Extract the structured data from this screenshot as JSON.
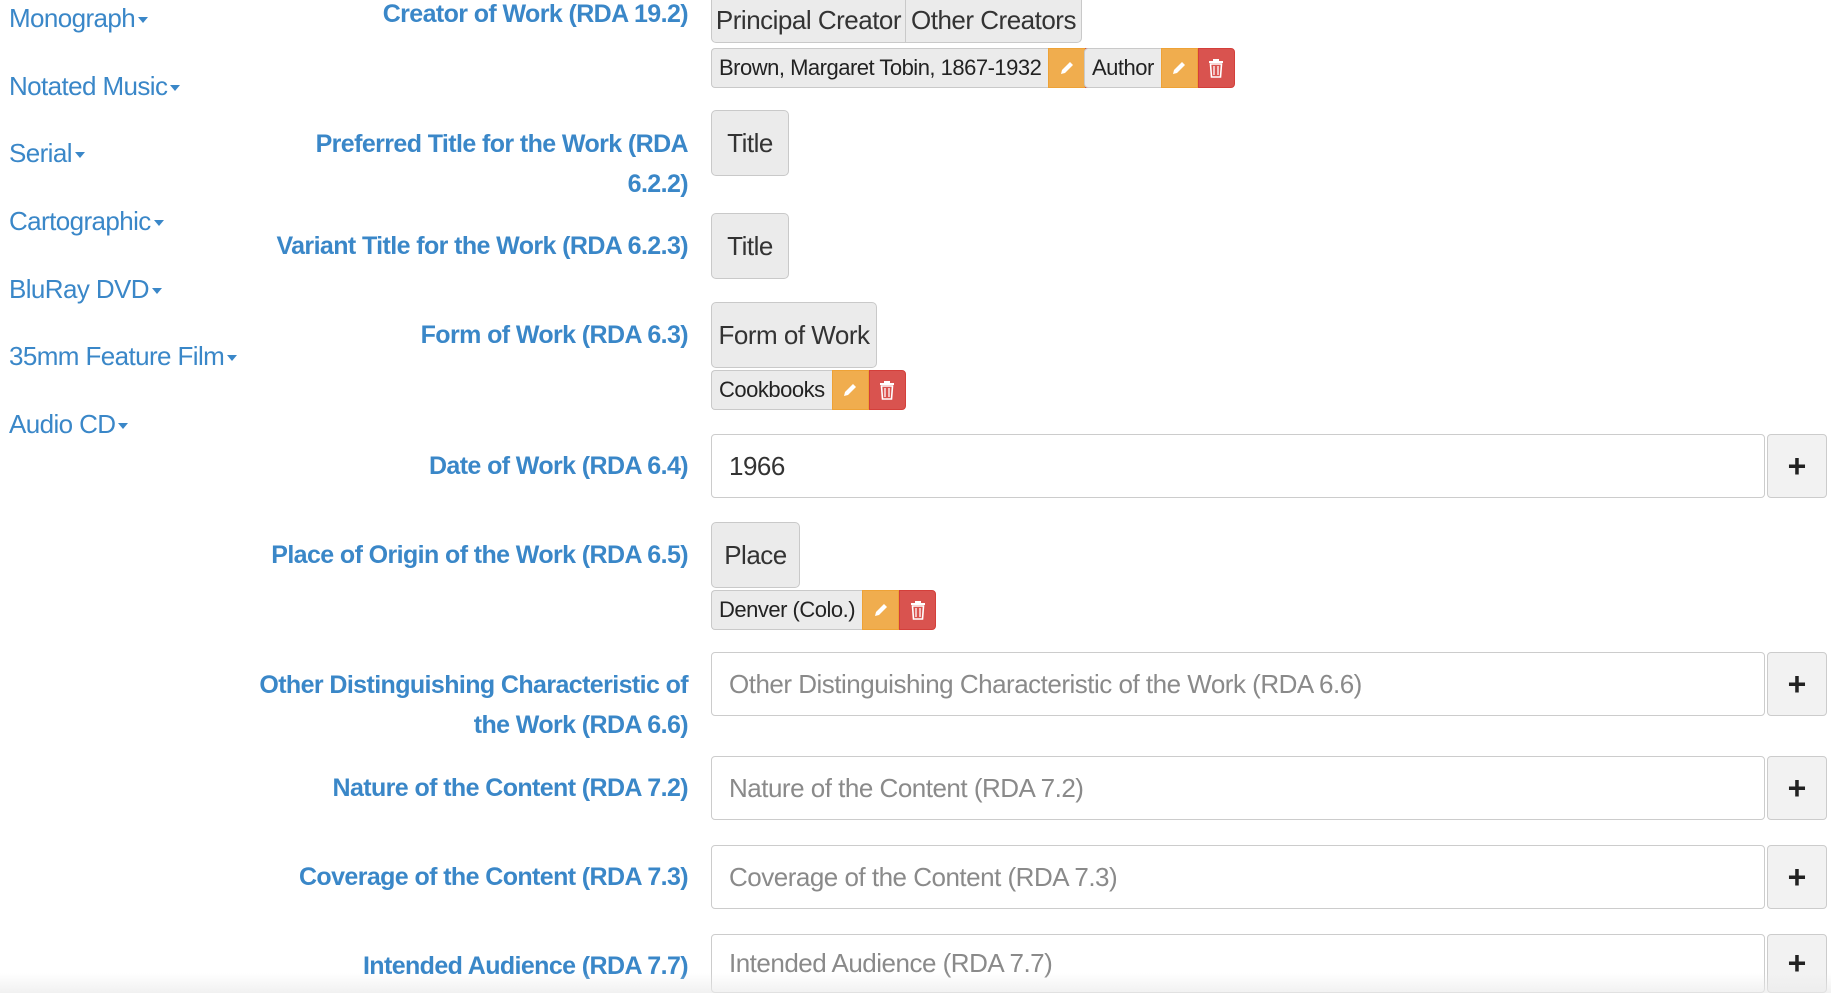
{
  "sidebar": {
    "items": [
      {
        "label": "Monograph"
      },
      {
        "label": "Notated Music"
      },
      {
        "label": "Serial"
      },
      {
        "label": "Cartographic"
      },
      {
        "label": "BluRay DVD"
      },
      {
        "label": "35mm Feature Film"
      },
      {
        "label": "Audio CD"
      }
    ]
  },
  "form": {
    "creator": {
      "label": "Creator of Work (RDA 19.2)",
      "principal_button": "Principal Creator",
      "other_button": "Other Creators",
      "chip_name": "Brown, Margaret Tobin, 1867-1932",
      "chip_role": "Author"
    },
    "preferred_title": {
      "label_line1": "Preferred Title for the Work (RDA",
      "label_line2": "6.2.2)",
      "button": "Title"
    },
    "variant_title": {
      "label": "Variant Title for the Work (RDA 6.2.3)",
      "button": "Title"
    },
    "form_of_work": {
      "label": "Form of Work (RDA 6.3)",
      "button": "Form of Work",
      "chip": "Cookbooks"
    },
    "date_of_work": {
      "label": "Date of Work (RDA 6.4)",
      "value": "1966",
      "add": "+"
    },
    "place_of_origin": {
      "label": "Place of Origin of the Work (RDA 6.5)",
      "button": "Place",
      "chip": "Denver (Colo.)"
    },
    "other_distinguishing": {
      "label_line1": "Other Distinguishing Characteristic of",
      "label_line2": "the Work (RDA 6.6)",
      "placeholder": "Other Distinguishing Characteristic of the Work (RDA 6.6)",
      "add": "+"
    },
    "nature_of_content": {
      "label": "Nature of the Content (RDA 7.2)",
      "placeholder": "Nature of the Content (RDA 7.2)",
      "add": "+"
    },
    "coverage_of_content": {
      "label": "Coverage of the Content (RDA 7.3)",
      "placeholder": "Coverage of the Content (RDA 7.3)",
      "add": "+"
    },
    "intended_audience": {
      "label": "Intended Audience (RDA 7.7)",
      "placeholder": "Intended Audience (RDA 7.7)",
      "add": "+"
    }
  },
  "icons": {
    "edit": "pencil-icon",
    "delete": "trash-icon"
  },
  "colors": {
    "link": "#3a87c8",
    "edit": "#f0ad4e",
    "delete": "#d9534f"
  }
}
